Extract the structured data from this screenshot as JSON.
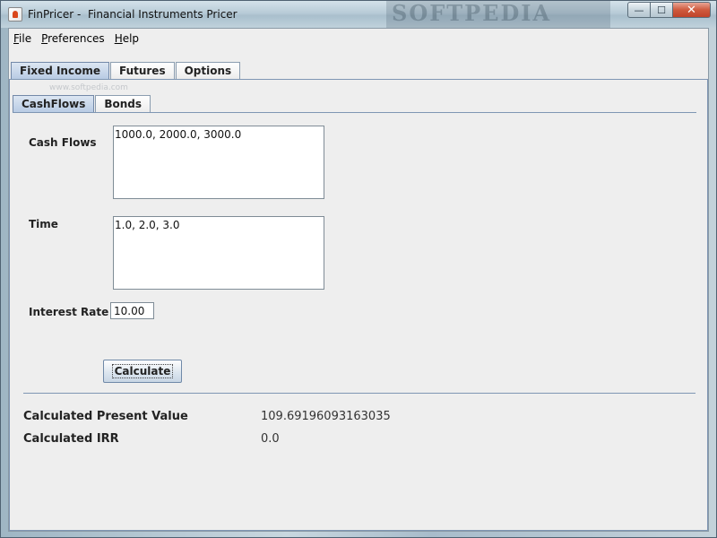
{
  "window": {
    "title": "FinPricer -  Financial Instruments Pricer",
    "watermark": "SOFTPEDIA",
    "controls": {
      "minimize": "—",
      "maximize": "☐",
      "close": "✕"
    }
  },
  "menu": {
    "file": {
      "mnemonic": "F",
      "rest": "ile"
    },
    "preferences": {
      "mnemonic": "P",
      "rest": "references"
    },
    "help": {
      "mnemonic": "H",
      "rest": "elp"
    }
  },
  "main_tabs": [
    {
      "label": "Fixed Income",
      "active": true
    },
    {
      "label": "Futures",
      "active": false
    },
    {
      "label": "Options",
      "active": false
    }
  ],
  "sub_tabs": [
    {
      "label": "CashFlows",
      "active": true
    },
    {
      "label": "Bonds",
      "active": false
    }
  ],
  "sub_watermark": "www.softpedia.com",
  "form": {
    "cash_flows_label": "Cash Flows",
    "cash_flows_value": "1000.0, 2000.0, 3000.0",
    "time_label": "Time",
    "time_value": "1.0, 2.0, 3.0",
    "interest_rate_label": "Interest Rate",
    "interest_rate_value": "10.00",
    "calculate_button": "Calculate"
  },
  "results": {
    "present_value_label": "Calculated Present Value",
    "present_value": "109.69196093163035",
    "irr_label": "Calculated IRR",
    "irr_value": "0.0"
  }
}
